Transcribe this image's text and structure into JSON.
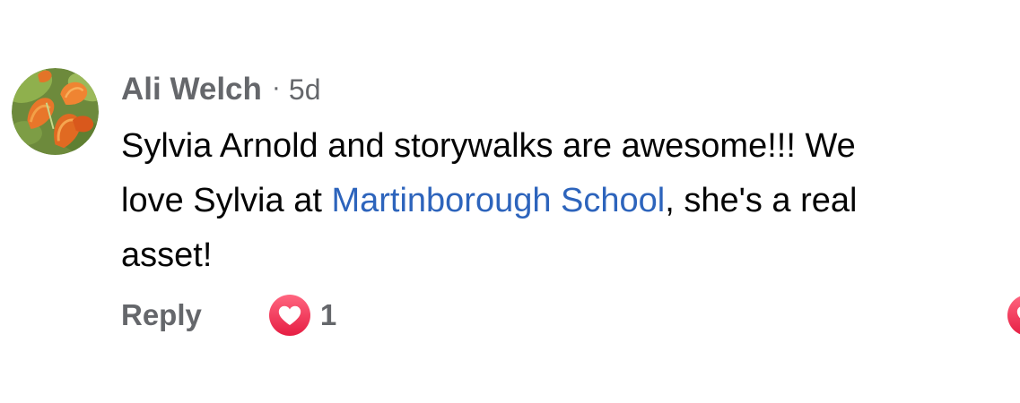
{
  "comment": {
    "author": "Ali Welch",
    "separator": "·",
    "timestamp": "5d",
    "avatar_icon": "calla-lily-flowers-photo",
    "text_before_mention": "Sylvia Arnold and storywalks are awesome!!! We",
    "text_line2_prefix": "love Sylvia at ",
    "mention": "Martinborough School",
    "text_after_mention": ", she's a real",
    "text_line3": "asset!",
    "reply_label": "Reply",
    "reaction_icon": "love-heart-icon",
    "reaction_count": "1"
  },
  "colors": {
    "secondary_text": "#65676b",
    "primary_text": "#050505",
    "mention_link": "#2d64bc",
    "love_reaction": "#f0284a"
  }
}
